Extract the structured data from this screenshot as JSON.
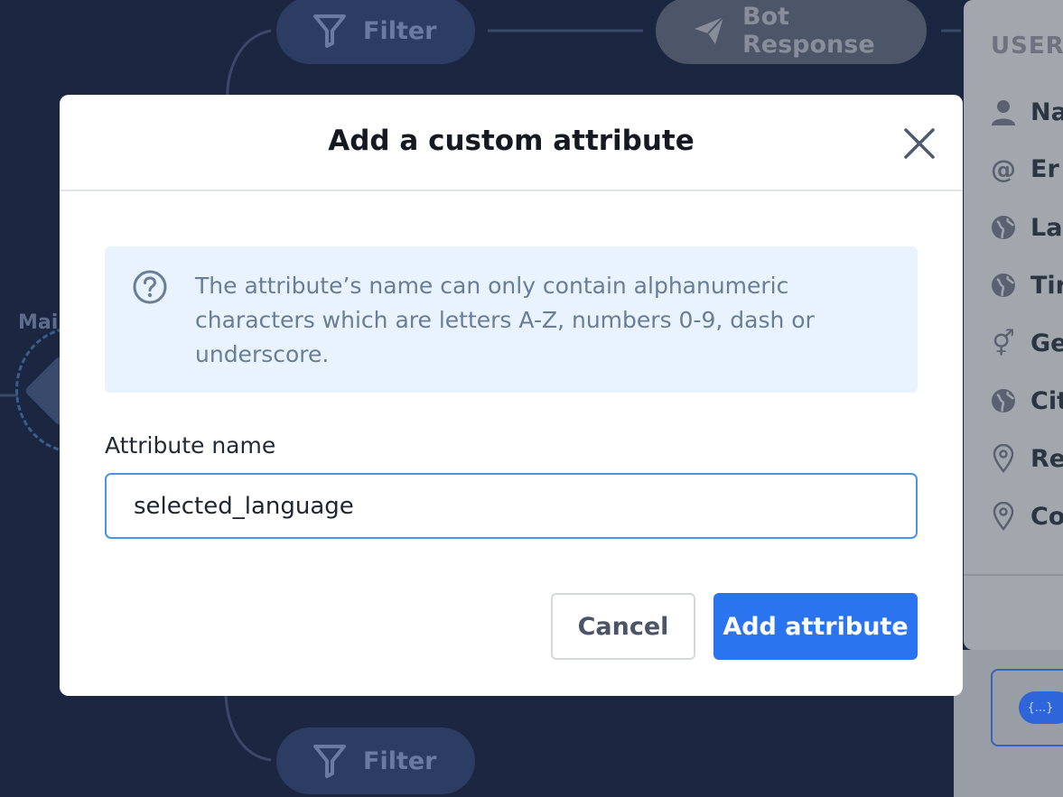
{
  "canvas": {
    "nodes": {
      "filter_top": "Filter",
      "bot_response": "Bot Response",
      "filter_bottom": "Filter",
      "main_label": "Mai"
    }
  },
  "user_panel": {
    "title": "USER",
    "items": [
      {
        "label": "Na",
        "icon": "person-icon"
      },
      {
        "label": "Er",
        "icon": "at-icon"
      },
      {
        "label": "La",
        "icon": "globe-icon"
      },
      {
        "label": "Tir",
        "icon": "globe-icon"
      },
      {
        "label": "Ge",
        "icon": "gender-icon"
      },
      {
        "label": "Cit",
        "icon": "globe-icon"
      },
      {
        "label": "Re",
        "icon": "map-pin-icon"
      },
      {
        "label": "Co",
        "icon": "map-pin-icon"
      }
    ],
    "badge": "{...}"
  },
  "modal": {
    "title": "Add a custom attribute",
    "info": "The attribute’s name can only contain alphanumeric characters which are letters A-Z, numbers 0-9, dash or underscore.",
    "field_label": "Attribute name",
    "field_value": "selected_language",
    "cancel_label": "Cancel",
    "submit_label": "Add attribute"
  },
  "colors": {
    "background": "#1b2740",
    "accent": "#2a74ef",
    "input_border": "#4795e4",
    "info_bg": "#e8f3fd"
  }
}
